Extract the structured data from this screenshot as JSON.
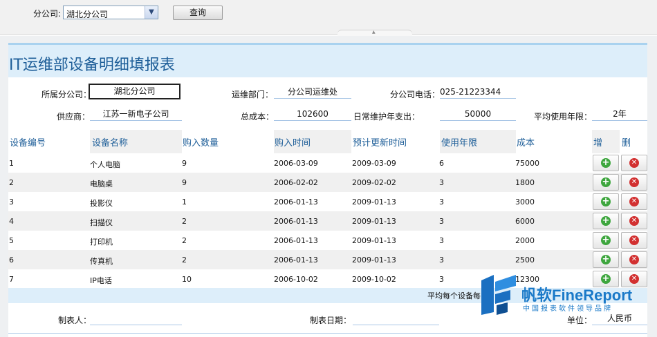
{
  "toolbar": {
    "branch_label": "分公司:",
    "branch_value": "湖北分公司",
    "query_label": "查询"
  },
  "report": {
    "title": "IT运维部设备明细填报表",
    "branch_label": "所属分公司：",
    "branch_value": "湖北分公司",
    "dept_label": "运维部门：",
    "dept_value": "分公司运维处",
    "phone_label": "分公司电话：",
    "phone_value": "025-21223344",
    "supplier_label": "供应商：",
    "supplier_value": "江苏一新电子公司",
    "total_cost_label": "总成本：",
    "total_cost_value": "102600",
    "maint_label": "日常维护年支出：",
    "maint_value": "50000",
    "avg_years_label": "平均使用年限：",
    "avg_years_value": "2年"
  },
  "table": {
    "headers": [
      "设备编号",
      "设备名称",
      "购入数量",
      "购入时间",
      "预计更新时间",
      "使用年限",
      "成本",
      "增",
      "删"
    ],
    "rows": [
      [
        "1",
        "个人电脑",
        "9",
        "2006-03-09",
        "2009-03-09",
        "6",
        "75000"
      ],
      [
        "2",
        "电脑桌",
        "9",
        "2006-02-02",
        "2009-02-02",
        "3",
        "1800"
      ],
      [
        "3",
        "投影仪",
        "1",
        "2006-01-13",
        "2009-01-13",
        "3",
        "3000"
      ],
      [
        "4",
        "扫描仪",
        "2",
        "2006-01-13",
        "2009-01-13",
        "3",
        "6000"
      ],
      [
        "5",
        "打印机",
        "2",
        "2006-01-13",
        "2009-01-13",
        "3",
        "2000"
      ],
      [
        "6",
        "传真机",
        "2",
        "2006-01-13",
        "2009-01-13",
        "3",
        "2500"
      ],
      [
        "7",
        "IP电话",
        "10",
        "2006-10-02",
        "2009-10-02",
        "3",
        "12300"
      ]
    ],
    "summary_label": "平均每个设备每"
  },
  "footer": {
    "maker_label": "制表人：",
    "date_label": "制表日期：",
    "unit_label": "单位：",
    "unit_value": "人民币"
  },
  "logo": {
    "brand": "帆软FineReport",
    "slogan": "中国报表软件领导品牌"
  },
  "colors": {
    "title": "#1f5f99",
    "title_bar": "#ddeefa",
    "add_icon": "#3ea63e",
    "delete_icon": "#d23030"
  }
}
